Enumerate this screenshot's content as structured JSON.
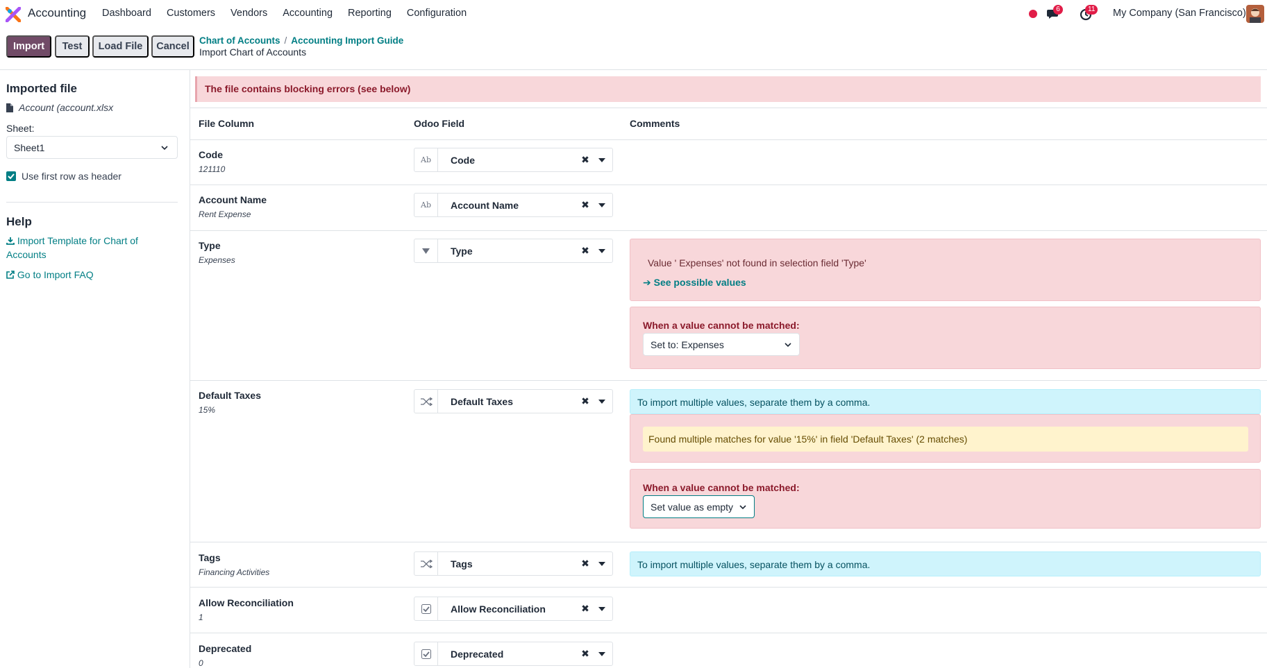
{
  "navbar": {
    "app_name": "Accounting",
    "menu": [
      "Dashboard",
      "Customers",
      "Vendors",
      "Accounting",
      "Reporting",
      "Configuration"
    ],
    "chat_badge": "6",
    "activity_badge": "11",
    "company": "My Company (San Francisco)"
  },
  "control_panel": {
    "import_label": "Import",
    "test_label": "Test",
    "load_file_label": "Load File",
    "cancel_label": "Cancel",
    "breadcrumb": [
      "Chart of Accounts",
      "Accounting Import Guide"
    ],
    "breadcrumb_sep": "/",
    "page_title": "Import Chart of Accounts"
  },
  "sidebar": {
    "imported_file_title": "Imported file",
    "file_name": "Account (account.xlsx",
    "sheet_label": "Sheet:",
    "sheet_value": "Sheet1",
    "use_header_label": "Use first row as header",
    "use_header_checked": true,
    "help_title": "Help",
    "template_link_line1": "Import Template for Chart of",
    "template_link_line2": "Accounts",
    "faq_link": "Go to Import FAQ"
  },
  "main": {
    "error_banner": "The file contains blocking errors (see below)",
    "headers": {
      "file_column": "File Column",
      "odoo_field": "Odoo Field",
      "comments": "Comments"
    },
    "rows": [
      {
        "column": "Code",
        "sample": "121110",
        "field": "Code",
        "field_icon": "text-icon"
      },
      {
        "column": "Account Name",
        "sample": "Rent Expense",
        "field": "Account Name",
        "field_icon": "text-icon"
      },
      {
        "column": "Type",
        "sample": "Expenses",
        "field": "Type",
        "field_icon": "selection-icon"
      },
      {
        "column": "Default Taxes",
        "sample": "15%",
        "field": "Default Taxes",
        "field_icon": "many2many-icon"
      },
      {
        "column": "Tags",
        "sample": "Financing Activities",
        "field": "Tags",
        "field_icon": "many2many-icon"
      },
      {
        "column": "Allow Reconciliation",
        "sample": "1",
        "field": "Allow Reconciliation",
        "field_icon": "boolean-icon"
      },
      {
        "column": "Deprecated",
        "sample": "0",
        "field": "Deprecated",
        "field_icon": "boolean-icon"
      }
    ],
    "text_icon_label": "Ab",
    "type_error": "Value ' Expenses' not found in selection field 'Type'",
    "see_possible_values": "See possible values",
    "unmatched_label": "When a value cannot be matched:",
    "type_fallback": "Set to: Expenses",
    "multi_values_info": "To import multiple values, separate them by a comma.",
    "taxes_warning": "Found multiple matches for value '15%' in field 'Default Taxes' (2 matches)",
    "taxes_fallback": "Set value as empty"
  },
  "colors": {
    "primary": "#714b67",
    "link": "#017e84",
    "danger_bg": "#f8d7da",
    "info_bg": "#cff4fc",
    "warning_bg": "#fff3cd",
    "badge": "#e11d48"
  }
}
